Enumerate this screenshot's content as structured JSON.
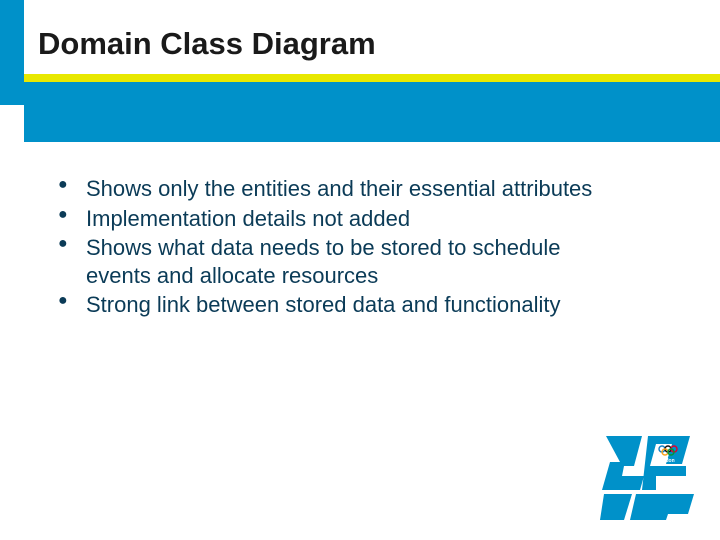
{
  "slide": {
    "title": "Domain Class Diagram",
    "bullets": [
      "Shows only the entities and their essential attributes",
      "Implementation details not added",
      "Shows what data needs to be stored to schedule events and allocate resources",
      "Strong link between stored data and functionality"
    ]
  },
  "colors": {
    "accent_blue": "#0091c9",
    "accent_yellow": "#e8e800",
    "text_dark": "#0b3b57"
  },
  "logo": {
    "name": "london-2012-olympics-logo"
  }
}
